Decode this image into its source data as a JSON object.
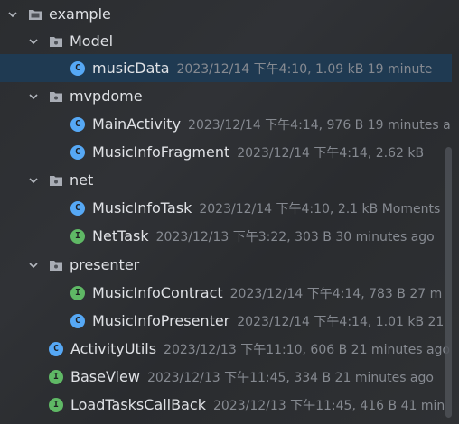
{
  "tree": {
    "items": [
      {
        "name": "example",
        "meta": "",
        "kind": "folder",
        "expanded": true,
        "icon": "folder-icon"
      },
      {
        "name": "Model",
        "meta": "",
        "kind": "folder",
        "expanded": true,
        "icon": "folder-icon"
      },
      {
        "name": "musicData",
        "meta": "2023/12/14 下午4:10, 1.09 kB 19 minute",
        "kind": "class",
        "badge": "C",
        "selected": true
      },
      {
        "name": "mvpdome",
        "meta": "",
        "kind": "folder",
        "expanded": true,
        "icon": "folder-icon"
      },
      {
        "name": "MainActivity",
        "meta": "2023/12/14 下午4:14, 976 B 19 minutes a",
        "kind": "class",
        "badge": "C"
      },
      {
        "name": "MusicInfoFragment",
        "meta": "2023/12/14 下午4:14, 2.62 kB",
        "kind": "class",
        "badge": "C"
      },
      {
        "name": "net",
        "meta": "",
        "kind": "folder",
        "expanded": true,
        "icon": "folder-icon"
      },
      {
        "name": "MusicInfoTask",
        "meta": "2023/12/14 下午4:10, 2.1 kB Moments",
        "kind": "class",
        "badge": "C"
      },
      {
        "name": "NetTask",
        "meta": "2023/12/13 下午3:22, 303 B 30 minutes ago",
        "kind": "interface",
        "badge": "I"
      },
      {
        "name": "presenter",
        "meta": "",
        "kind": "folder",
        "expanded": true,
        "icon": "folder-icon"
      },
      {
        "name": "MusicInfoContract",
        "meta": "2023/12/14 下午4:14, 783 B 27 m",
        "kind": "interface",
        "badge": "I"
      },
      {
        "name": "MusicInfoPresenter",
        "meta": "2023/12/14 下午4:14, 1.01 kB 21",
        "kind": "class",
        "badge": "C"
      },
      {
        "name": "ActivityUtils",
        "meta": "2023/12/13 下午11:10, 606 B 21 minutes ago",
        "kind": "class",
        "badge": "C"
      },
      {
        "name": "BaseView",
        "meta": "2023/12/13 下午11:45, 334 B 21 minutes ago",
        "kind": "interface",
        "badge": "I"
      },
      {
        "name": "LoadTasksCallBack",
        "meta": "2023/12/13 下午11:45, 416 B 41 min",
        "kind": "interface",
        "badge": "I"
      }
    ]
  },
  "colors": {
    "background": "#2b2d30",
    "selected_row": "#1f3a52",
    "class_badge": "#56a8f5",
    "interface_badge": "#5fb865",
    "name_text": "#dfe1e5",
    "meta_text": "#868a91"
  }
}
